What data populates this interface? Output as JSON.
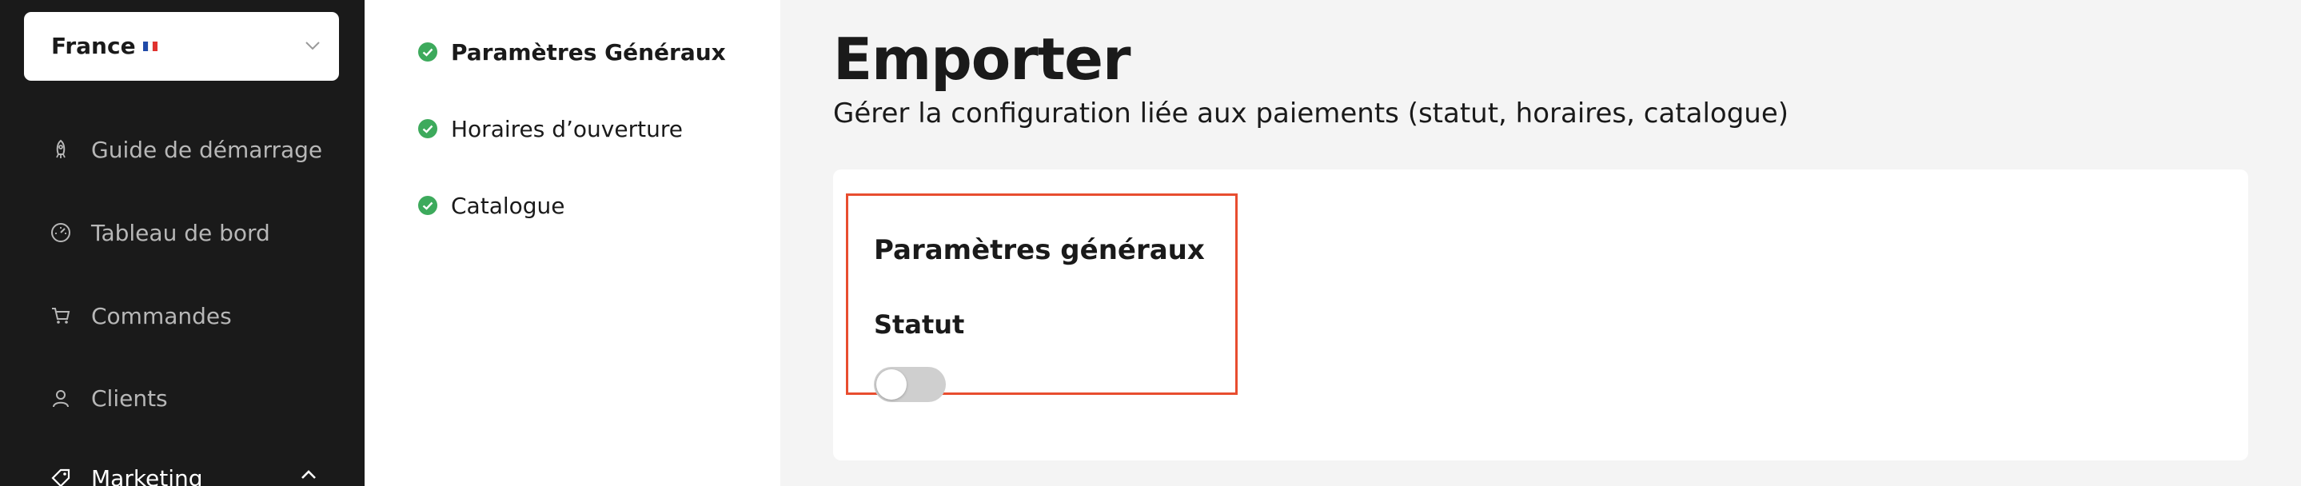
{
  "sidebar": {
    "country": {
      "label": "France",
      "flag_colors": [
        "#1f4aa8",
        "#ffffff",
        "#e0322e"
      ]
    },
    "items": [
      {
        "label": "Guide de démarrage",
        "icon": "rocket-icon"
      },
      {
        "label": "Tableau de bord",
        "icon": "dashboard-gauge-icon"
      },
      {
        "label": "Commandes",
        "icon": "cart-icon"
      },
      {
        "label": "Clients",
        "icon": "user-icon"
      },
      {
        "label": "Marketing",
        "icon": "tag-icon",
        "expanded": true
      }
    ]
  },
  "steps": [
    {
      "label": "Paramètres Généraux",
      "done": true,
      "current": true
    },
    {
      "label": "Horaires d’ouverture",
      "done": true,
      "current": false
    },
    {
      "label": "Catalogue",
      "done": true,
      "current": false
    }
  ],
  "main": {
    "title": "Emporter",
    "subtitle": "Gérer la configuration liée aux paiements (statut, horaires, catalogue)",
    "section": {
      "title": "Paramètres généraux",
      "status_label": "Statut",
      "status_on": false
    }
  },
  "colors": {
    "sidebar_bg": "#1a1a1a",
    "check_green": "#3daa5c",
    "highlight_border": "#e84d2f"
  }
}
